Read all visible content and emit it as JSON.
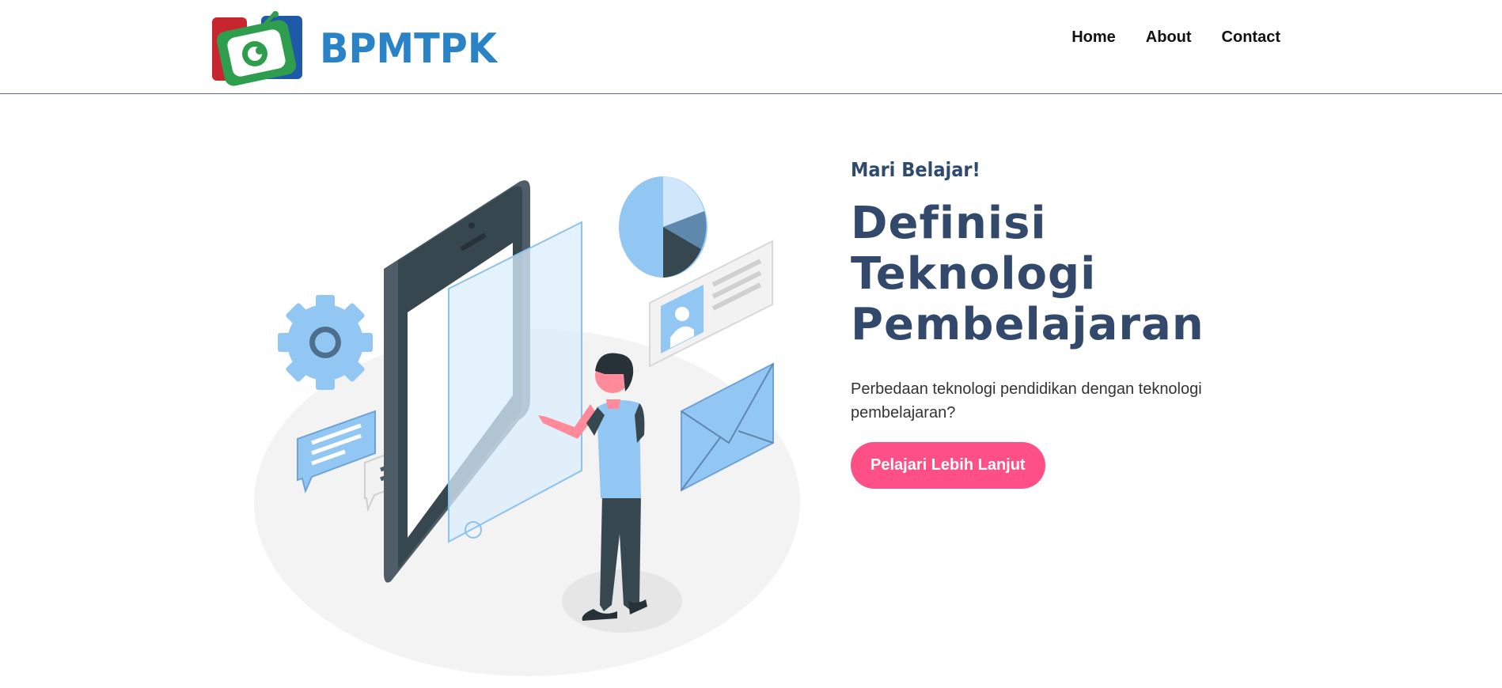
{
  "brand": {
    "name": "BPMTPK"
  },
  "nav": {
    "items": [
      {
        "label": "Home"
      },
      {
        "label": "About"
      },
      {
        "label": "Contact"
      }
    ]
  },
  "hero": {
    "eyebrow": "Mari Belajar!",
    "title_line1": "Definisi Teknologi",
    "title_line2": "Pembelajaran",
    "subtitle": "Perbedaan teknologi pendidikan dengan teknologi pembelajaran?",
    "cta_label": "Pelajari Lebih Lanjut"
  },
  "colors": {
    "brand_blue": "#2a83c6",
    "cta_pink": "#ff4f87",
    "heading_navy": "#33496b",
    "illustration_blue": "#92c7f4",
    "device_dark": "#37474f"
  }
}
